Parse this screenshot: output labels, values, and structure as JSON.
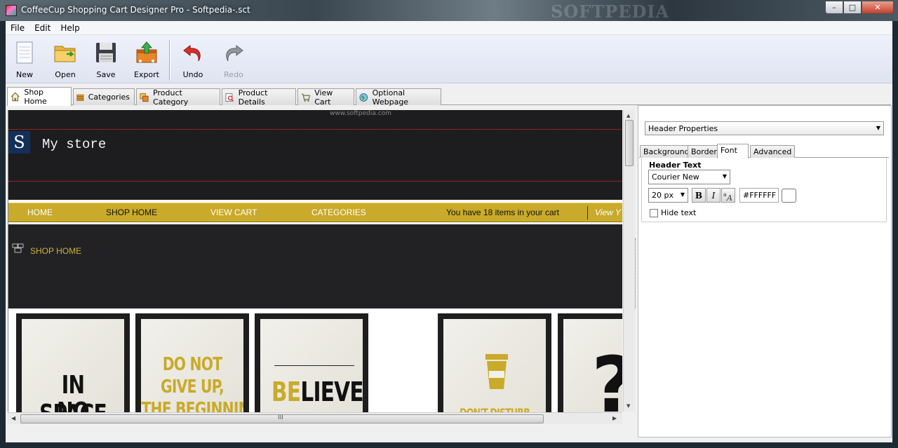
{
  "window": {
    "title": "CoffeeCup Shopping Cart Designer Pro - Softpedia-.sct",
    "watermark": "SOFTPEDIA",
    "min_glyph": "–",
    "max_glyph": "□",
    "close_glyph": "✕"
  },
  "menu": [
    "File",
    "Edit",
    "Help"
  ],
  "toolbar": {
    "new": "New",
    "open": "Open",
    "save": "Save",
    "export": "Export",
    "undo": "Undo",
    "redo": "Redo"
  },
  "tabs": [
    {
      "label": "Shop Home",
      "icon": "home-icon"
    },
    {
      "label": "Categories",
      "icon": "categories-icon"
    },
    {
      "label": "Product Category",
      "icon": "product-category-icon"
    },
    {
      "label": "Product Details",
      "icon": "product-details-icon"
    },
    {
      "label": "View Cart",
      "icon": "cart-icon"
    },
    {
      "label": "Optional Webpage",
      "icon": "globe-icon"
    }
  ],
  "canvas": {
    "watermark": "www.softpedia.com",
    "logo_letter": "S",
    "store_name": "My store",
    "nav": [
      "HOME",
      "SHOP HOME",
      "VIEW CART",
      "CATEGORIES"
    ],
    "cart_info": "You have 18 items in your cart",
    "view_link": "View Y",
    "section_title": "SHOP HOME",
    "products": [
      {
        "line1": "IN SPACE",
        "line2": "NO ONE"
      },
      {
        "line1": "DO NOT",
        "line2": "GIVE UP,",
        "line3": "THE BEGINNING"
      },
      {
        "accent": "BE",
        "line1": "LIEVE"
      },
      {
        "line1": "DON'T DISTURB"
      },
      {
        "line1": "?"
      }
    ],
    "accent_color": "#c9aa2a"
  },
  "scroll": {
    "up": "▲",
    "down": "▼",
    "left": "◀",
    "right": "▶",
    "grip": "III"
  },
  "properties": {
    "selector": "Header Properties",
    "tabs": [
      "Background",
      "Border",
      "Font",
      "Advanced"
    ],
    "active_tab": "Font",
    "section": "Header Text",
    "font_family": "Courier New",
    "font_size": "20 px",
    "bold": "B",
    "italic": "I",
    "color_value": "#FFFFFF",
    "hide_text_label": "Hide text"
  }
}
